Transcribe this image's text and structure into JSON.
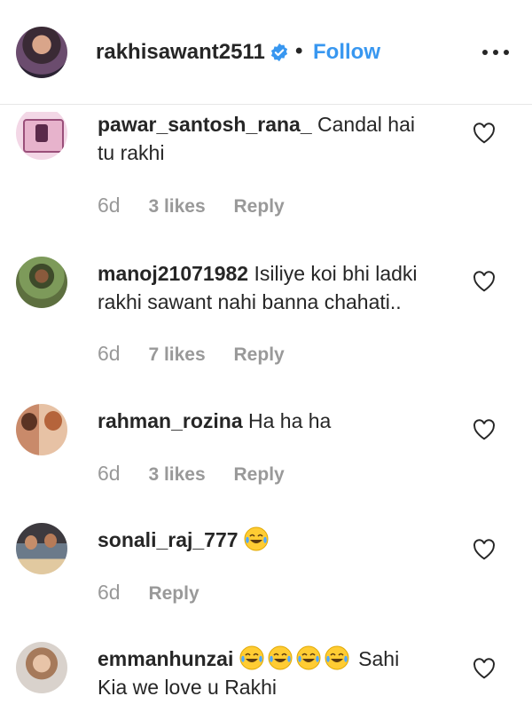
{
  "header": {
    "username": "rakhisawant2511",
    "separator": "•",
    "follow_label": "Follow"
  },
  "comments": [
    {
      "username": "pawar_santosh_rana_",
      "text_line1": " Candal hai",
      "text_line2": "tu rakhi",
      "age": "6d",
      "likes": "3 likes",
      "reply": "Reply"
    },
    {
      "username": "manoj21071982",
      "text_line1": " Isiliye koi bhi ladki",
      "text_line2": "rakhi sawant nahi banna chahati..",
      "age": "6d",
      "likes": "7 likes",
      "reply": "Reply"
    },
    {
      "username": "rahman_rozina",
      "text_line1": " Ha ha ha",
      "age": "6d",
      "likes": "3 likes",
      "reply": "Reply"
    },
    {
      "username": "sonali_raj_777",
      "emoji_name": "tears-of-joy-emoji",
      "age": "6d",
      "reply": "Reply"
    },
    {
      "username": "emmanhunzai",
      "emoji_name": "tears-of-joy-emoji",
      "text_line1": " Sahi",
      "text_line2": "Kia we love u Rakhi"
    }
  ],
  "colors": {
    "link_blue": "#3897f0",
    "text": "#262626",
    "muted": "#999999",
    "verified_blue": "#3897f0"
  }
}
